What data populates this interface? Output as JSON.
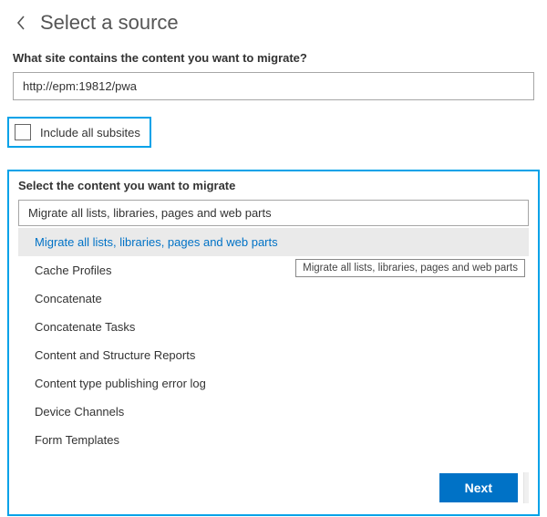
{
  "header": {
    "title": "Select a source"
  },
  "siteField": {
    "label": "What site contains the content you want to migrate?",
    "value": "http://epm:19812/pwa"
  },
  "subsitesCheckbox": {
    "label": "Include all subsites",
    "checked": false
  },
  "contentPanel": {
    "heading": "Select the content you want to migrate",
    "selectedValue": "Migrate all lists, libraries, pages and web parts",
    "tooltip": "Migrate all lists, libraries, pages and web parts",
    "options": [
      "Migrate all lists, libraries, pages and web parts",
      "Cache Profiles",
      "Concatenate",
      "Concatenate Tasks",
      "Content and Structure Reports",
      "Content type publishing error log",
      "Device Channels",
      "Form Templates"
    ]
  },
  "footer": {
    "nextLabel": "Next"
  },
  "colors": {
    "accent": "#0072c6",
    "highlightBorder": "#00a2e8"
  }
}
